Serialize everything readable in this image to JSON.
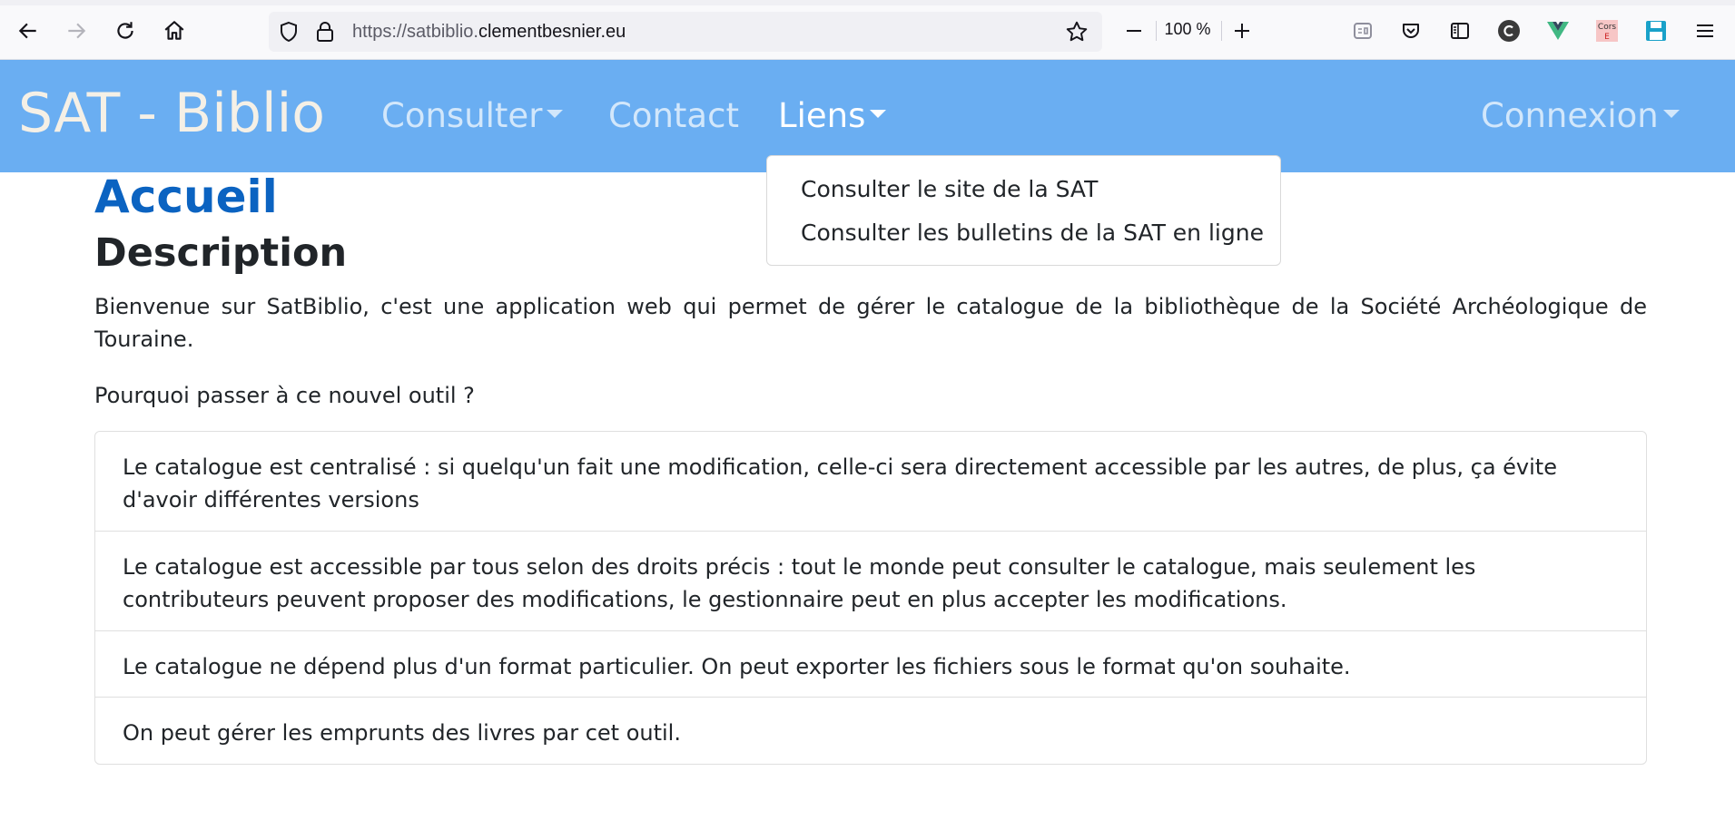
{
  "browser": {
    "url_prefix": "https://satbiblio.",
    "url_host": "clementbesnier.eu",
    "zoom": "100 %",
    "extension_corsE_label": "Cors\nE"
  },
  "navbar": {
    "brand": "SAT - Biblio",
    "links": [
      {
        "label": "Consulter",
        "dropdown": true
      },
      {
        "label": "Contact",
        "dropdown": false
      },
      {
        "label": "Liens",
        "dropdown": true,
        "active": true
      }
    ],
    "right_link": {
      "label": "Connexion",
      "dropdown": true
    },
    "colors": {
      "background": "#6aaef2",
      "brand": "#f5f0e6"
    }
  },
  "dropdown": {
    "items": [
      "Consulter le site de la SAT",
      "Consulter les bulletins de la SAT en ligne"
    ]
  },
  "content": {
    "title": "Accueil",
    "section": "Description",
    "intro": "Bienvenue sur SatBiblio, c'est une application web qui permet de gérer le catalogue de la bibliothèque de la Société Archéologique de Touraine.",
    "question": "Pourquoi passer à ce nouvel outil ?",
    "reasons": [
      "Le catalogue est centralisé : si quelqu'un fait une modification, celle-ci sera directement accessible par les autres, de plus, ça évite d'avoir différentes versions",
      "Le catalogue est accessible par tous selon des droits précis : tout le monde peut consulter le catalogue, mais seulement les contributeurs peuvent proposer des modifications, le gestionnaire peut en plus accepter les modifications.",
      "Le catalogue ne dépend plus d'un format particulier. On peut exporter les fichiers sous le format qu'on souhaite.",
      "On peut gérer les emprunts des livres par cet outil."
    ],
    "colors": {
      "title": "#0b63c1"
    }
  }
}
